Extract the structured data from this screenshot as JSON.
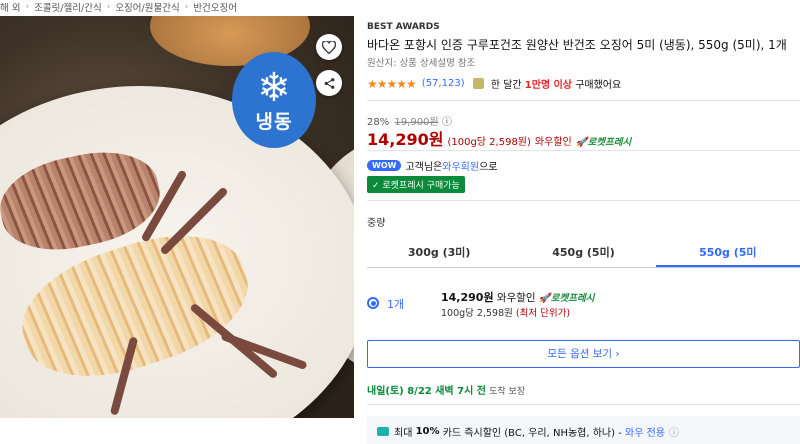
{
  "breadcrumb": [
    "해 외",
    "조콜릿/젤리/간식",
    "오징어/원물간식",
    "반건오징어"
  ],
  "image": {
    "badge_label": "냉동",
    "badge_icon": "snowflake-icon",
    "badge_color": "#2c74d0"
  },
  "product": {
    "award": "BEST AWARDS",
    "title": "바다온 포항시 인증 구루포건조 원양산 반건조 오징어 5미 (냉동), 550g (5미), 1개",
    "origin": "원산지: 상품 상세설명 참조",
    "stars": "★★★★★",
    "rating_value": 4.5,
    "review_count": "(57,123)",
    "bought_prefix": "한 달간",
    "bought_highlight": "1만명 이상",
    "bought_suffix": "구매했어요"
  },
  "pricing": {
    "discount_rate": "28%",
    "original_price": "19,900원",
    "info_icon": "ⓘ",
    "price": "14,290원",
    "unit_price": "(100g당 2,598원)",
    "wow_label": "와우할인",
    "rocket_label": "🚀로켓프레시"
  },
  "membership": {
    "badge": "WOW",
    "text_prefix": "고객님은",
    "text_link": "와우회원",
    "text_suffix": "으로",
    "rocket_box": "✓ 로켓프레시 구매가능"
  },
  "weight": {
    "label": "중량",
    "options": [
      "300g (3미)",
      "450g (5미)",
      "550g (5미"
    ],
    "selected_index": 2
  },
  "choice": {
    "qty": "1개",
    "price": "14,290원",
    "wow": "와우할인",
    "rocket": "🚀로켓프레시",
    "unit": "100g당 2,598원",
    "lowest": "(최저 단위가)"
  },
  "all_options": "모든 옵션 보기 ›",
  "delivery": {
    "date": "내일(토) 8/22 새벽 7시 전",
    "suffix": "도착 보장"
  },
  "card": {
    "prefix": "최대",
    "rate": "10%",
    "body": "카드 즉시할인 (BC, 우리, NH농협, 하나) -",
    "wow": "와우 전용",
    "info_icon": "ⓘ"
  }
}
